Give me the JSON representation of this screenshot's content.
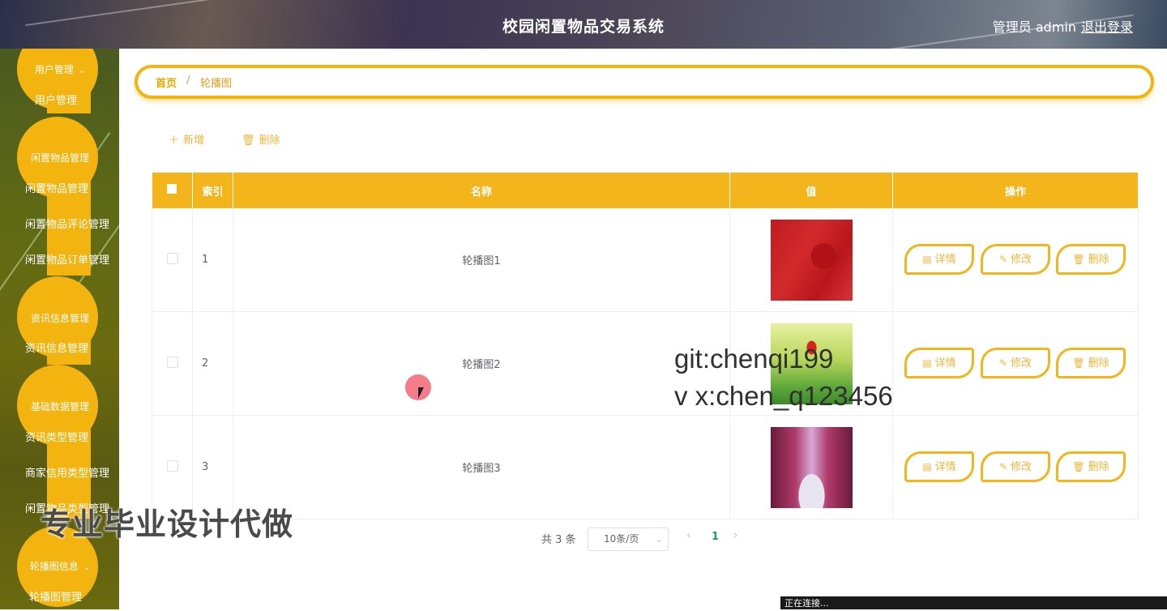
{
  "header": {
    "title": "校园闲置物品交易系统",
    "user": "管理员 admin",
    "logout": "退出登录"
  },
  "sidebar": {
    "groups": [
      {
        "title": "用户管理",
        "items": [
          "用户管理"
        ]
      },
      {
        "title": "闲置物品管理",
        "items": [
          "闲置物品管理",
          "闲置物品评论管理",
          "闲置物品订单管理"
        ]
      },
      {
        "title": "资讯信息管理",
        "items": [
          "资讯信息管理"
        ]
      },
      {
        "title": "基础数据管理",
        "items": [
          "资讯类型管理",
          "商家信用类型管理",
          "闲置物品类型管理"
        ]
      },
      {
        "title": "轮播图信息",
        "items": [
          "轮播图管理"
        ]
      }
    ]
  },
  "breadcrumb": {
    "home": "首页",
    "separator": "/",
    "current": "轮播图"
  },
  "toolbar": {
    "add": "新增",
    "delete": "删除"
  },
  "table": {
    "columns": [
      "索引",
      "名称",
      "值",
      "操作"
    ],
    "rows": [
      {
        "index": "1",
        "name": "轮播图1",
        "image": "red-abstract"
      },
      {
        "index": "2",
        "name": "轮播图2",
        "image": "green-field-red-flower"
      },
      {
        "index": "3",
        "name": "轮播图3",
        "image": "stage-spotlights"
      }
    ],
    "actions": {
      "detail": "详情",
      "edit": "修改",
      "delete": "删除"
    }
  },
  "pagination": {
    "total": "共 3 条",
    "page_size": "10条/页",
    "current_page": "1"
  },
  "overlay": {
    "watermark_line1": "git:chenqi199",
    "watermark_line2": "v x:chen_q123456",
    "promo": "专业毕业设计代做",
    "status": "正在连接..."
  },
  "colors": {
    "accent": "#f3b41c",
    "link": "#f0b53c",
    "active_page": "#1e9e6a"
  }
}
